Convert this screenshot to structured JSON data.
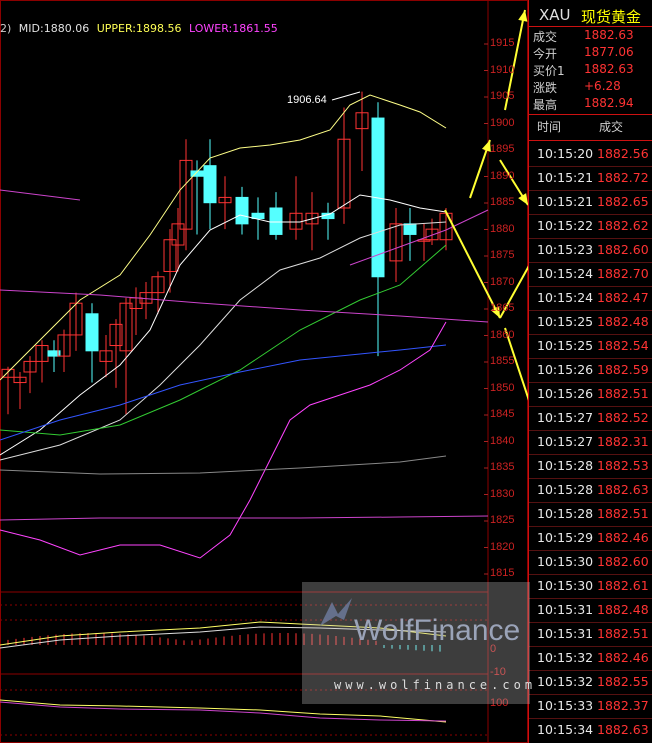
{
  "info_bar": {
    "prefix": "2)",
    "mid": "MID:1880.06",
    "upper": "UPPER:1898.56",
    "lower": "LOWER:1861.55"
  },
  "chart": {
    "peak_label": "1906.64",
    "price_scale": [
      "1915",
      "1910",
      "1905",
      "1900",
      "1895",
      "1890",
      "1885",
      "1880",
      "1875",
      "1870",
      "1865",
      "1860",
      "1855",
      "1850",
      "1845",
      "1840",
      "1835",
      "1830",
      "1825",
      "1820",
      "1815"
    ],
    "indicator_scale": [
      "0",
      "-10",
      "100"
    ],
    "colors": {
      "up_candle": "#ff3333",
      "down_candle": "#55ffff",
      "upper_band": "#ffff88",
      "lower_band": "#ff44ff",
      "ma_white": "#ffffff",
      "ma_green": "#33cc33",
      "ma_blue": "#3355ff",
      "annotation_arrow": "#ffff33",
      "grid": "#8b0000"
    }
  },
  "quote_panel": {
    "symbol": "XAU",
    "name": "现货黄金",
    "rows": [
      {
        "label": "成交",
        "value": "1882.63"
      },
      {
        "label": "今开",
        "value": "1877.06"
      },
      {
        "label": "买价1",
        "value": "1882.63"
      },
      {
        "label": "涨跌",
        "value": "+6.28"
      },
      {
        "label": "最高",
        "value": "1882.94"
      }
    ],
    "tick_header": {
      "time": "时间",
      "price": "成交"
    },
    "ticks": [
      {
        "time": "10:15:20",
        "price": "1882.56"
      },
      {
        "time": "10:15:21",
        "price": "1882.72"
      },
      {
        "time": "10:15:21",
        "price": "1882.65"
      },
      {
        "time": "10:15:22",
        "price": "1882.62"
      },
      {
        "time": "10:15:23",
        "price": "1882.60"
      },
      {
        "time": "10:15:24",
        "price": "1882.70"
      },
      {
        "time": "10:15:24",
        "price": "1882.47"
      },
      {
        "time": "10:15:25",
        "price": "1882.48"
      },
      {
        "time": "10:15:25",
        "price": "1882.54"
      },
      {
        "time": "10:15:26",
        "price": "1882.59"
      },
      {
        "time": "10:15:26",
        "price": "1882.51"
      },
      {
        "time": "10:15:27",
        "price": "1882.52"
      },
      {
        "time": "10:15:27",
        "price": "1882.31"
      },
      {
        "time": "10:15:28",
        "price": "1882.53"
      },
      {
        "time": "10:15:28",
        "price": "1882.63"
      },
      {
        "time": "10:15:28",
        "price": "1882.51"
      },
      {
        "time": "10:15:29",
        "price": "1882.46"
      },
      {
        "time": "10:15:30",
        "price": "1882.60"
      },
      {
        "time": "10:15:30",
        "price": "1882.61"
      },
      {
        "time": "10:15:31",
        "price": "1882.48"
      },
      {
        "time": "10:15:31",
        "price": "1882.51"
      },
      {
        "time": "10:15:32",
        "price": "1882.46"
      },
      {
        "time": "10:15:32",
        "price": "1882.55"
      },
      {
        "time": "10:15:33",
        "price": "1882.37"
      },
      {
        "time": "10:15:34",
        "price": "1882.63"
      }
    ]
  },
  "watermark": {
    "logo": "WolfFinance",
    "url": "www.wolfinance.com"
  }
}
